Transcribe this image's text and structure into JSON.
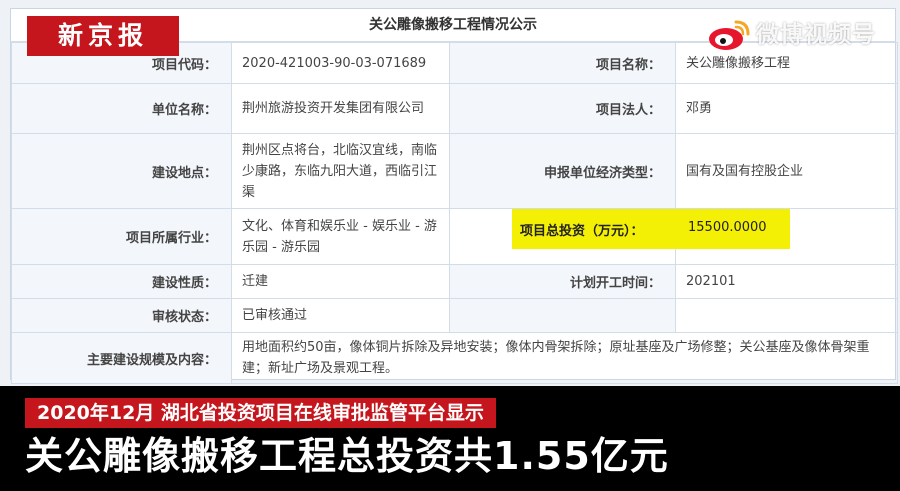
{
  "logo": {
    "text": "新京报"
  },
  "watermark": {
    "text": "微博视频号"
  },
  "panel": {
    "title": "关公雕像搬移工程情况公示"
  },
  "rows": [
    {
      "label1": "项目代码：",
      "value1": "2020-421003-90-03-071689",
      "label2": "项目名称：",
      "value2": "关公雕像搬移工程"
    },
    {
      "label1": "单位名称：",
      "value1": "荆州旅游投资开发集团有限公司",
      "label2": "项目法人：",
      "value2": "邓勇"
    },
    {
      "label1": "建设地点：",
      "value1": "荆州区点将台，北临汉宜线，南临少康路，东临九阳大道，西临引江渠",
      "label2": "申报单位经济类型：",
      "value2": "国有及国有控股企业"
    },
    {
      "label1": "项目所属行业：",
      "value1": "文化、体育和娱乐业 - 娱乐业 - 游乐园 - 游乐园",
      "label2": "项目总投资（万元）：",
      "value2": "15500.0000"
    },
    {
      "label1": "建设性质：",
      "value1": "迁建",
      "label2": "计划开工时间：",
      "value2": "202101"
    },
    {
      "label1": "审核状态：",
      "value1": "已审核通过",
      "label2": "",
      "value2": ""
    }
  ],
  "scope": {
    "label": "主要建设规模及内容：",
    "value": "用地面积约50亩，像体铜片拆除及异地安装；像体内骨架拆除；原址基座及广场修整；关公基座及像体骨架重建；新址广场及景观工程。"
  },
  "caption": {
    "line1": "2020年12月 湖北省投资项目在线审批监管平台显示",
    "line2": "关公雕像搬移工程总投资共1.55亿元"
  },
  "colors": {
    "brand_red": "#c4161c",
    "highlight": "#f4f005",
    "weibo_red": "#e6162d"
  }
}
